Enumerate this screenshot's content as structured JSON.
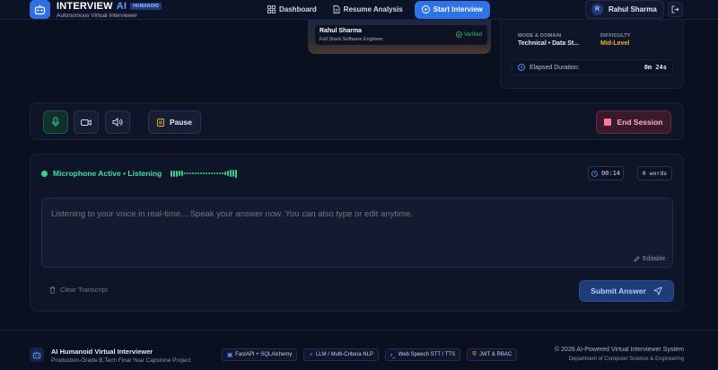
{
  "header": {
    "brand_title": "INTERVIEW",
    "brand_ai": "AI",
    "brand_badge": "HUMANOID",
    "brand_subtitle": "Autonomous Virtual Interviewer",
    "nav": {
      "dashboard": "Dashboard",
      "resume_analysis": "Resume Analysis",
      "start_interview": "Start Interview"
    },
    "user": {
      "initial": "R",
      "name": "Rahul Sharma"
    },
    "icons": [
      "robot-icon",
      "grid-icon",
      "document-icon",
      "play-icon",
      "logout-icon"
    ]
  },
  "candidate": {
    "name": "Rahul Sharma",
    "role": "Full Stack Software Engineer",
    "verified": "Verified"
  },
  "session_info": {
    "mode_label": "MODE & DOMAIN",
    "mode_value": "Technical • Data St...",
    "difficulty_label": "DIFFICULTY",
    "difficulty_value": "Mid-Level",
    "elapsed_label": "Elapsed Duration:",
    "elapsed_value": "0m 24s"
  },
  "controls": {
    "pause_label": "Pause",
    "end_label": "End Session",
    "icons": [
      "microphone-icon",
      "camera-icon",
      "speaker-icon",
      "pause-icon",
      "stop-icon"
    ]
  },
  "transcript": {
    "status_text": "Microphone Active • Listening",
    "timer": "00:14",
    "word_count": "0 words",
    "placeholder": "Listening to your voice in real-time... Speak your answer now. You can also type or edit anytime.",
    "editable_label": "Editable",
    "clear_label": "Clear Transcript",
    "submit_label": "Submit Answer"
  },
  "footer": {
    "title": "AI Humanoid Virtual Interviewer",
    "subtitle": "Production-Grade B.Tech Final Year Capstone Project",
    "tech": [
      {
        "icon": "▣",
        "label": "FastAPI + SQLAlchemy"
      },
      {
        "icon": "⚡",
        "label": "LLM / Multi-Criteria NLP"
      },
      {
        "icon": "›_",
        "label": "Web Speech STT / TTS"
      },
      {
        "icon": "⛨",
        "label": "JWT & RBAC"
      }
    ],
    "copyright": "© 2026 AI-Powered Virtual Interviewer System",
    "department": "Department of Computer Science & Engineering"
  },
  "colors": {
    "background": "#0b1020",
    "accent_blue": "#2f74e6",
    "listening_green": "#2dd48a",
    "danger": "#ff7a92",
    "level_amber": "#f0b429"
  }
}
